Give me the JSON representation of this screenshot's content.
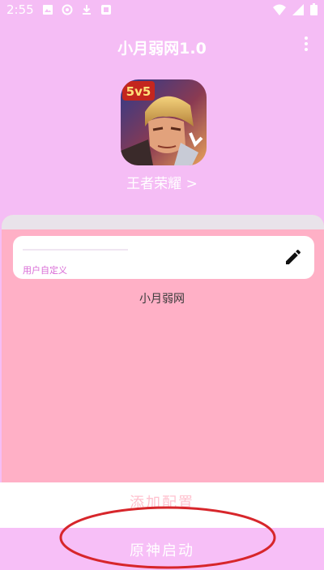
{
  "status_bar": {
    "time": "2:55",
    "left_icons": [
      "image-icon",
      "cast-icon",
      "download-icon",
      "app-icon"
    ],
    "right_icons": [
      "wifi-icon",
      "signal-icon",
      "battery-icon"
    ]
  },
  "appbar": {
    "title": "小月弱网1.0",
    "menu_icon": "more-vert-icon"
  },
  "game": {
    "icon_badge": "5v5",
    "name": "王者荣耀 >"
  },
  "config_card": {
    "label": "用户自定义",
    "edit_icon": "edit-icon"
  },
  "config_name": "小月弱网",
  "buttons": {
    "add_config": "添加配置",
    "launch": "原神启动"
  },
  "colors": {
    "background": "#f5bdf5",
    "sheet": "#ffb0c6",
    "annotation": "#d7262b"
  }
}
